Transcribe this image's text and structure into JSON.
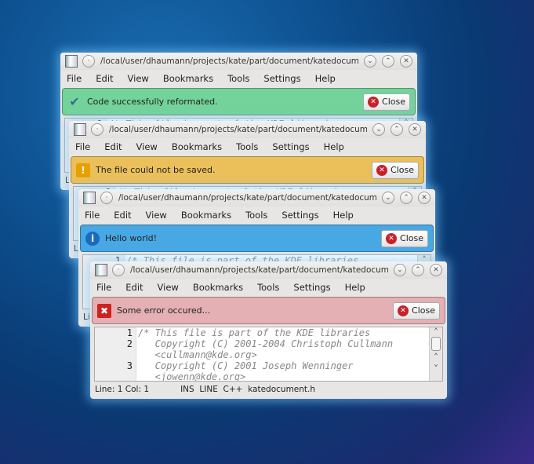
{
  "title": "/local/user/dhaumann/projects/kate/part/document/katedocument.h...",
  "menu": [
    "File",
    "Edit",
    "View",
    "Bookmarks",
    "Tools",
    "Settings",
    "Help"
  ],
  "close_label": "Close",
  "windows": [
    {
      "message": "Code successfully reformated.",
      "icon": "checkmark-icon",
      "color": "#74d39a"
    },
    {
      "message": "The file could not be saved.",
      "icon": "warning-icon",
      "color": "#ebc05a"
    },
    {
      "message": "Hello world!",
      "icon": "info-icon",
      "color": "#48a8e4"
    },
    {
      "message": "Some error occured...",
      "icon": "error-icon",
      "color": "#e4b0b4"
    }
  ],
  "editor": {
    "gutter": [
      "1",
      "2",
      "",
      "3",
      ""
    ],
    "lines": [
      "/* This file is part of the KDE libraries",
      "   Copyright (C) 2001-2004 Christoph Cullmann",
      "   <cullmann@kde.org>",
      "   Copyright (C) 2001 Joseph Wenninger",
      "   <jowenn@kde.org>"
    ]
  },
  "status": {
    "position": "Line: 1 Col: 1",
    "mode": "INS",
    "select": "LINE",
    "syntax": "C++",
    "file": "katedocument.h"
  }
}
